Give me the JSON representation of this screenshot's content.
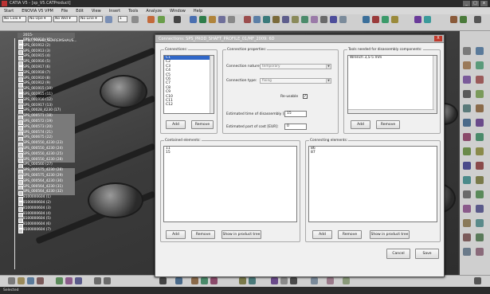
{
  "window": {
    "title": "CATIA V5 - [sp_V5.CATProduct]"
  },
  "menu": [
    "Start",
    "ENOVIA V5 VPM",
    "File",
    "Edit",
    "View",
    "Insert",
    "Tools",
    "Analyze",
    "Window",
    "Help"
  ],
  "toolbar": {
    "combos": [
      "No Colo ▾",
      "No Ope ▾",
      "No Wid ▾",
      "No Line ▾",
      "1"
    ]
  },
  "tree": {
    "root": "2015-07DT_PRAHB_SCHREMSHAUS...",
    "items": [
      "SPS_001910 (01)",
      "SPS_001912 (2)",
      "SPS_001913 (3)",
      "SPS_001915 (4)",
      "SPS_001916 (5)",
      "SPS_001917 (6)",
      "SPS_001918 (7)",
      "SPS_001910 (8)",
      "SPS_001912 (9)",
      "SPS_001915 (10)",
      "SPS_001915 (11)",
      "SPS_001916 (12)",
      "SPS_001917 (13)",
      "SPS_00028_4230 (17)",
      "SPS_000571 (18)",
      "SPS_000572 (19)",
      "SPS_000573 (20)",
      "SPS_000574 (21)",
      "SPS_000675 (22)",
      "SPS_000550_4230 (23)",
      "SPS_000550_4230 (24)",
      "SPS_000550_4230 (25)",
      "SPS_000550_4230 (28)",
      "SPS_000560 (27)",
      "SPS_000575_4230 (28)",
      "SPS_000575_4230 (29)",
      "SPS_000564_4230 (30)",
      "SPS_000564_4230 (31)",
      "SPS_000564_4230 (32)",
      "8100000604 (1)",
      "8100000604 (2)",
      "8100000604 (3)",
      "8100000604 (4)",
      "8100000604 (5)",
      "8100000604 (6)",
      "8100000604 (7)"
    ]
  },
  "dialog": {
    "title": "Connections: SPS_PROD_SHAFT_PROFILE_01/MF_2009: 6D",
    "close": "X",
    "connections": {
      "group_label": "Connections:",
      "items": [
        "C1",
        "C2",
        "C3",
        "C4",
        "C5",
        "C6",
        "C7",
        "C8",
        "C9",
        "C10",
        "C11",
        "C12"
      ],
      "selected": "C1",
      "add": "Add",
      "remove": "Remove"
    },
    "properties": {
      "group_label": "Connection properties:",
      "nature_label": "Connection nature:",
      "nature_value": "temporary",
      "type_label": "Connection type:",
      "type_value": "fixing",
      "reusable_label": "Re-usable",
      "reusable_checked": true,
      "check_mark": "✓",
      "time_label": "Estimated time of disassembly [s]:",
      "time_value": "15",
      "cost_label": "Estimated part of cost [EUR]:",
      "cost_value": "0"
    },
    "tools": {
      "group_label": "Tools needed for disassembly components:",
      "items": [
        "Wrench 3,5-5 mm"
      ],
      "add": "Add",
      "remove": "Remove"
    },
    "contained": {
      "group_label": "Contained elements:",
      "items": [
        "11",
        "15"
      ],
      "add": "Add",
      "remove": "Remove",
      "show": "Show in product tree"
    },
    "connecting": {
      "group_label": "Connecting elements:",
      "items": [
        "86",
        "87"
      ],
      "add": "Add",
      "remove": "Remove",
      "show": "Show in product tree"
    },
    "cancel": "Cancel",
    "save": "Save"
  },
  "status": {
    "text": "Selected"
  },
  "colors": {
    "accent_selection": "#3067c8",
    "titlebar": "#2b2b2b"
  }
}
